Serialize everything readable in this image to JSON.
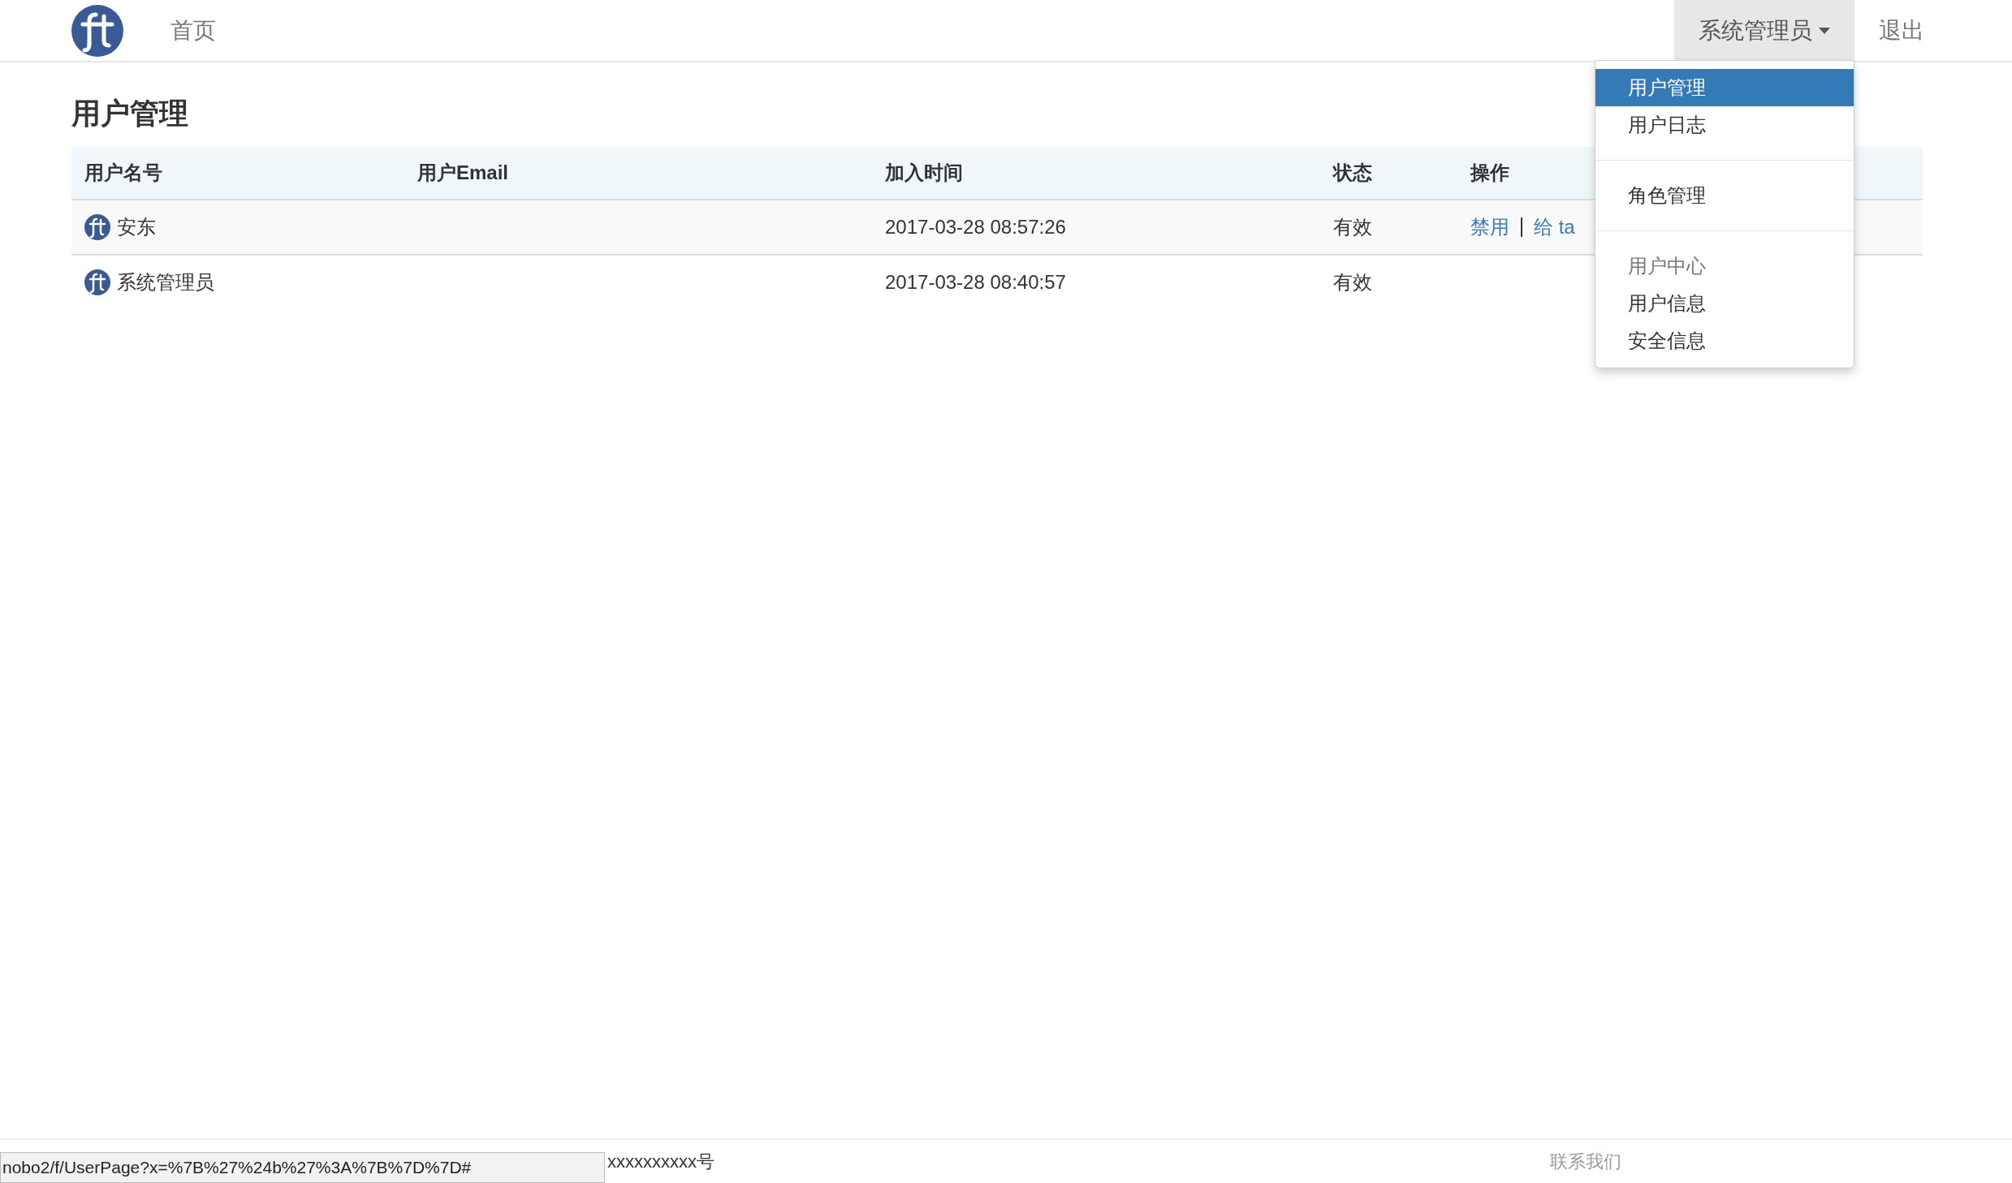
{
  "navbar": {
    "home_link": "首页",
    "user_menu": {
      "label": "系统管理员",
      "expanded": true
    },
    "logout": "退出"
  },
  "page_title": "用户管理",
  "table": {
    "columns": [
      "用户名号",
      "用户Email",
      "加入时间",
      "状态",
      "操作"
    ],
    "rows": [
      {
        "name": "安东",
        "email": "",
        "joined": "2017-03-28 08:57:26",
        "status": "有效",
        "actions": [
          "禁用",
          "给 ta"
        ]
      },
      {
        "name": "系统管理员",
        "email": "",
        "joined": "2017-03-28 08:40:57",
        "status": "有效",
        "actions": []
      }
    ]
  },
  "dropdown": [
    {
      "kind": "item",
      "label": "用户管理",
      "selected": true
    },
    {
      "kind": "item",
      "label": "用户日志",
      "selected": false
    },
    {
      "kind": "divider"
    },
    {
      "kind": "item",
      "label": "角色管理",
      "selected": false
    },
    {
      "kind": "divider"
    },
    {
      "kind": "header",
      "label": "用户中心"
    },
    {
      "kind": "item",
      "label": "用户信息",
      "selected": false
    },
    {
      "kind": "item",
      "label": "安全信息",
      "selected": false
    }
  ],
  "footer": {
    "notice": "xxxxxxxxxx号",
    "contact_link": "联系我们"
  },
  "status_bar": {
    "url": "nobo2/f/UserPage?x=%7B%27%24b%27%3A%7B%7D%7D#"
  }
}
